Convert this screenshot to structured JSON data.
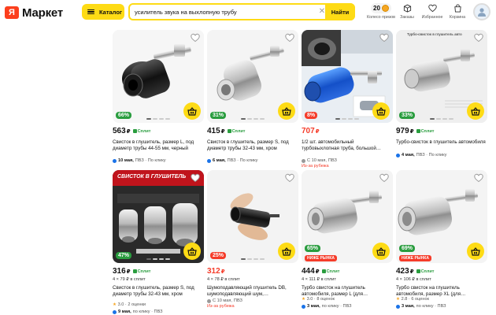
{
  "header": {
    "logo_ya": "Я",
    "logo_text": "Маркет",
    "catalog_label": "Каталог",
    "search_value": "усилитель звука на выхлопную трубу",
    "search_button": "Найти",
    "coins_count": "20",
    "coins_label": "Колесо призов",
    "orders_label": "Заказы",
    "favorites_label": "Избранное",
    "cart_label": "Корзина"
  },
  "colors": {
    "accent_yellow": "#fedb15",
    "discount_green": "#2a9d3f",
    "sale_red": "#f53c2a"
  },
  "pay_label": "Сплит",
  "products": [
    {
      "discount": "66%",
      "price": "563",
      "currency": "₽",
      "install": "",
      "title": "Свисток в глушитель, размер L, под диаметр трубы 44-55 мм, черный",
      "rating": "",
      "delivery_date": "10 мая,",
      "delivery_place": "ПВЗ · По клику",
      "abroad": ""
    },
    {
      "discount": "31%",
      "price": "415",
      "currency": "₽",
      "install": "",
      "title": "Свисток в глушитель, размер S, под диаметр трубы 32-43 мм, хром",
      "rating": "",
      "delivery_date": "6 мая,",
      "delivery_place": "ПВЗ · По клику",
      "abroad": ""
    },
    {
      "discount": "8%",
      "price": "707",
      "currency": "₽",
      "install": "",
      "title": "1/2 шт. автомобильный турбовыхлопная труба, большой…",
      "rating": "",
      "delivery_date": "С 10 мая,",
      "delivery_place": "ПВЗ",
      "abroad": "Из-за рубежа"
    },
    {
      "discount": "33%",
      "price": "979",
      "currency": "₽",
      "install": "",
      "title": "Турбо-свисток в глушитель автомобиля",
      "rating": "",
      "delivery_date": "4 мая,",
      "delivery_place": "ПВЗ · По клику",
      "abroad": ""
    },
    {
      "discount": "47%",
      "price": "316",
      "currency": "₽",
      "install": "4 × 79 ₽ в сплит",
      "title": "Свисток в глушитель, размер S, под диаметр трубы 32-43 мм, хром",
      "rating": "3.0 · 2 оценки",
      "delivery_date": "9 мая,",
      "delivery_place": "по клику · ПВЗ",
      "abroad": ""
    },
    {
      "discount": "25%",
      "price": "312",
      "currency": "₽",
      "install": "4 × 78 ₽ в сплит",
      "title": "Шумоподавляющий глушитель DB, шумоподавляющий шум,…",
      "rating": "",
      "delivery_date": "С 10 мая,",
      "delivery_place": "ПВЗ",
      "abroad": "Из-за рубежа"
    },
    {
      "discount": "65%",
      "low_price": "НИЖЕ РЫНКА",
      "price": "444",
      "currency": "₽",
      "install": "4 × 111 ₽ в сплит",
      "title": "Турбо свисток на глушитель автомобиля, размер L (для…",
      "rating": "3.0 · 8 оценок",
      "delivery_date": "3 мая,",
      "delivery_place": "по клику · ПВЗ",
      "abroad": ""
    },
    {
      "discount": "69%",
      "low_price": "НИЖЕ РЫНКА",
      "price": "423",
      "currency": "₽",
      "install": "4 × 106 ₽ в сплит",
      "title": "Турбо свисток на глушитель автомобиля, размер XL (для…",
      "rating": "2.8 · 6 оценок",
      "delivery_date": "3 мая,",
      "delivery_place": "по клику · ПВЗ",
      "abroad": ""
    }
  ],
  "image_texts": {
    "p4_banner": "Турбо-свисток в глушитель авто",
    "p5_banner": "СВИСТОК В ГЛУШИТЕЛЬ"
  }
}
